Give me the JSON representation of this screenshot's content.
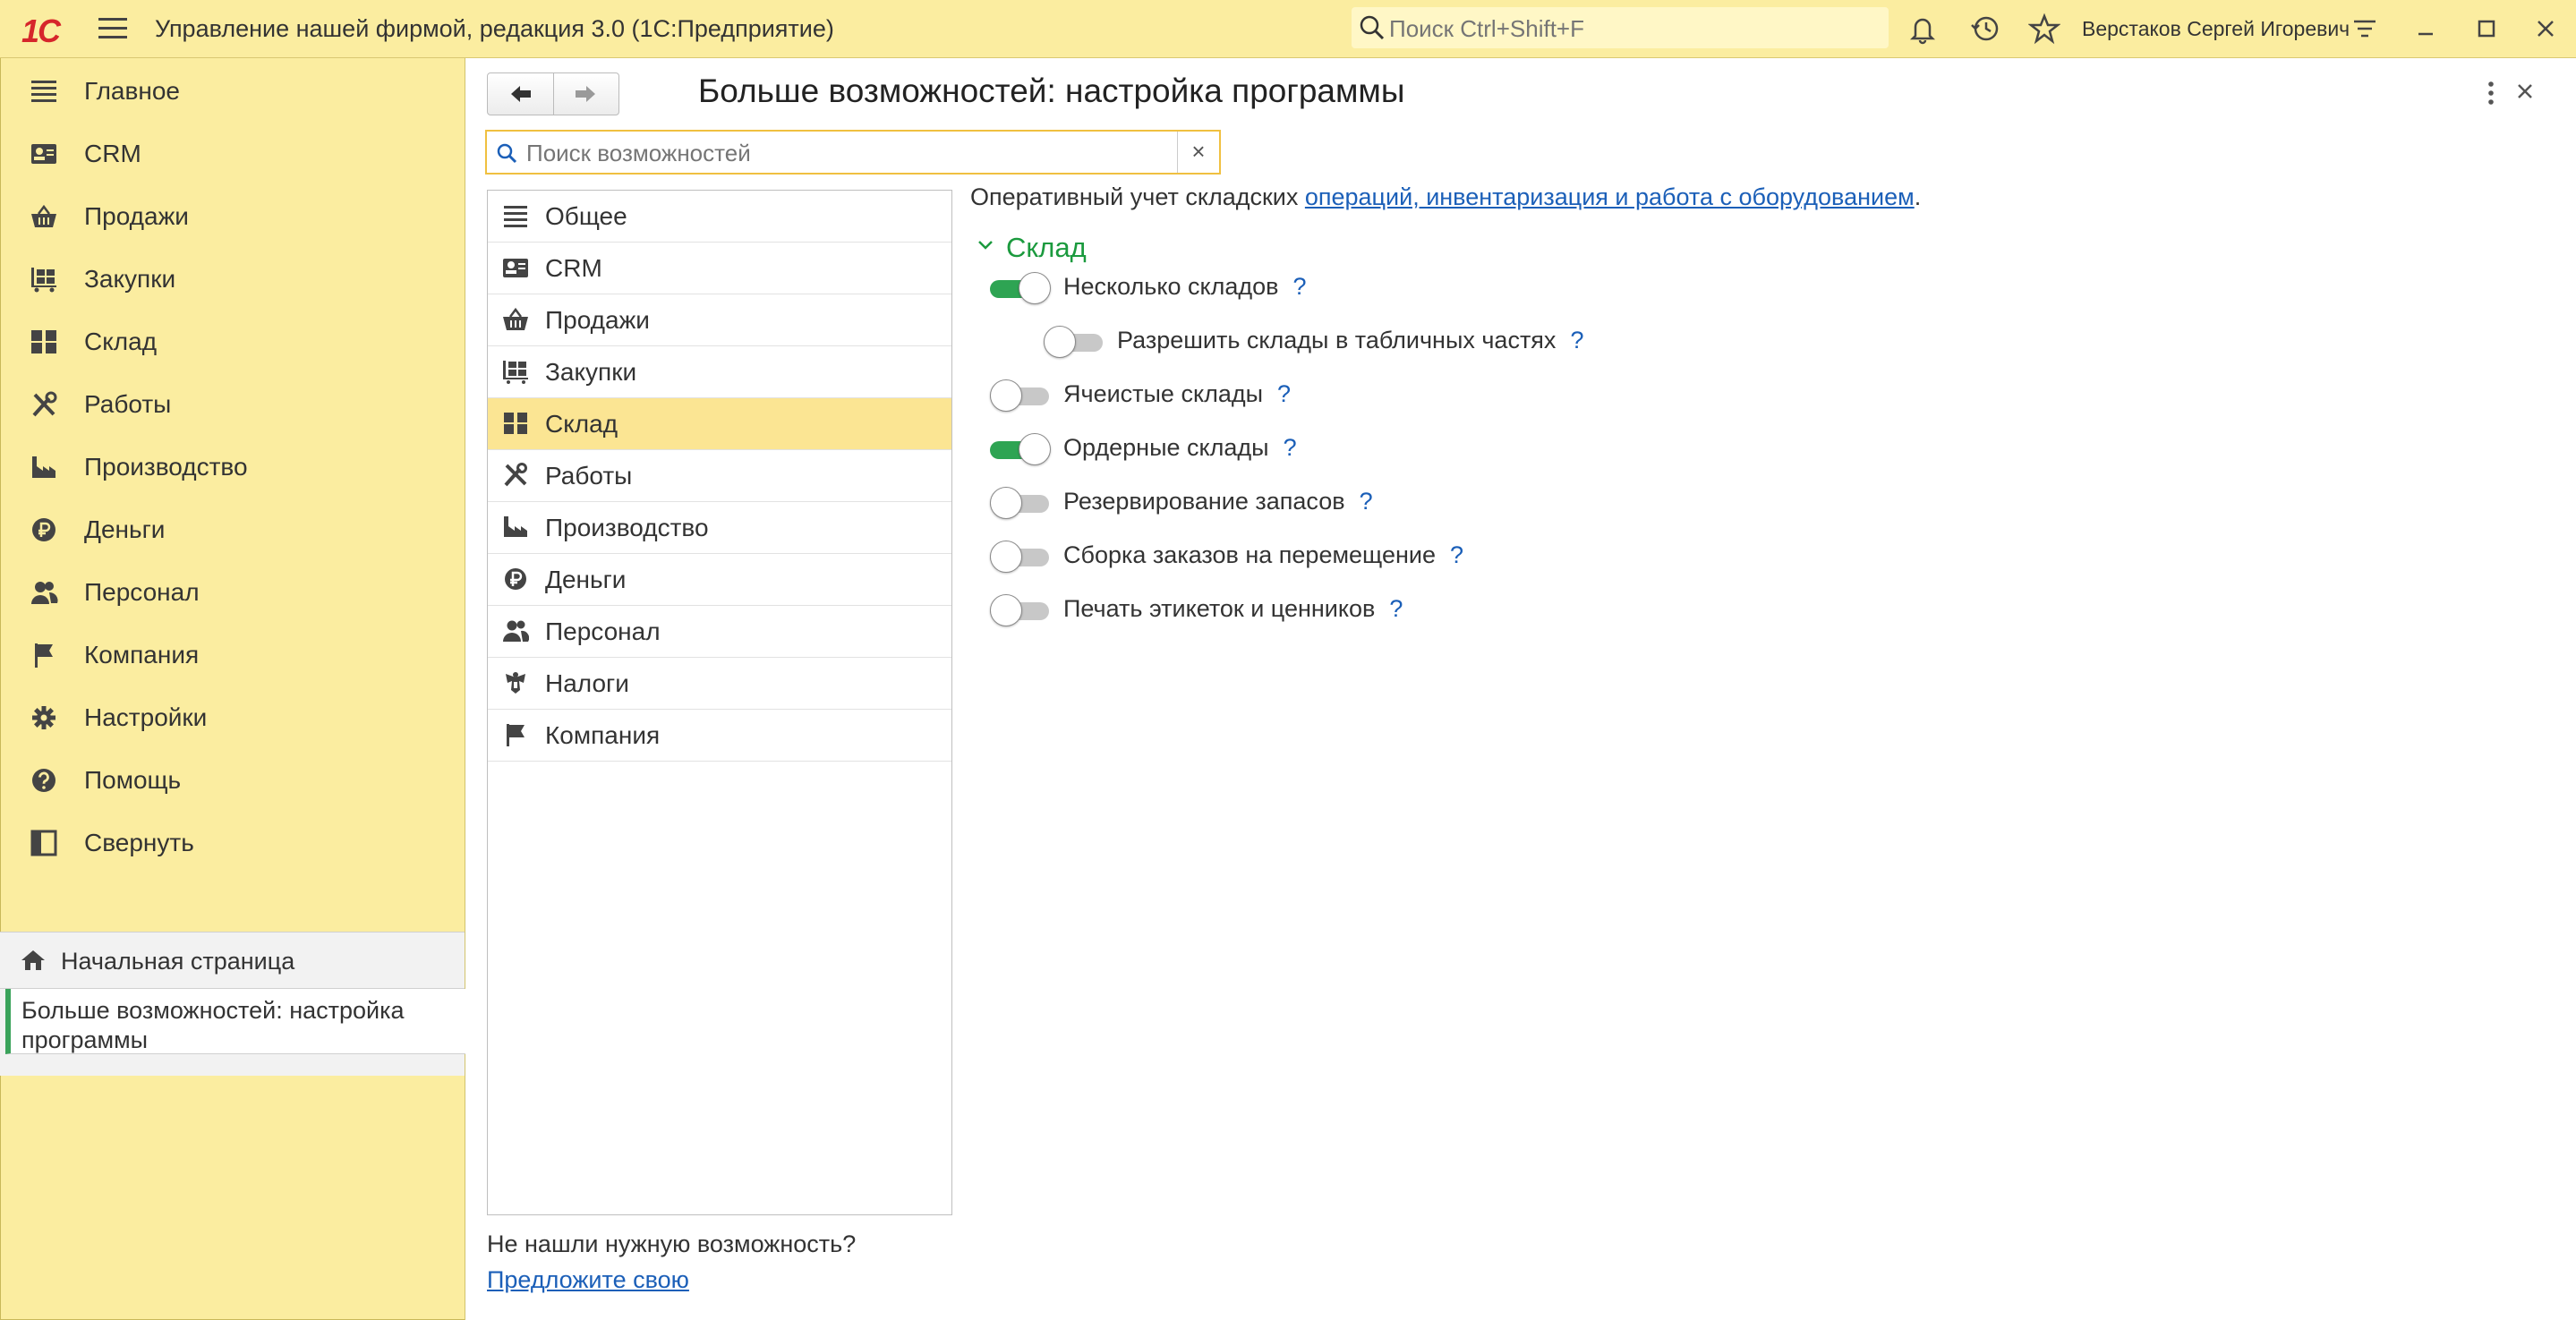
{
  "app": {
    "title": "Управление нашей фирмой, редакция 3.0  (1С:Предприятие)",
    "logo_text": "1С",
    "search_placeholder": "Поиск Ctrl+Shift+F",
    "user_name": "Верстаков Сергей Игоревич"
  },
  "sidebar": {
    "items": [
      {
        "label": "Главное",
        "icon": "list-icon"
      },
      {
        "label": "CRM",
        "icon": "contacts-icon"
      },
      {
        "label": "Продажи",
        "icon": "basket-icon"
      },
      {
        "label": "Закупки",
        "icon": "cart-icon"
      },
      {
        "label": "Склад",
        "icon": "grid-icon"
      },
      {
        "label": "Работы",
        "icon": "tools-icon"
      },
      {
        "label": "Производство",
        "icon": "factory-icon"
      },
      {
        "label": "Деньги",
        "icon": "ruble-icon"
      },
      {
        "label": "Персонал",
        "icon": "people-icon"
      },
      {
        "label": "Компания",
        "icon": "flag-icon"
      },
      {
        "label": "Настройки",
        "icon": "gear-icon"
      },
      {
        "label": "Помощь",
        "icon": "help-icon"
      },
      {
        "label": "Свернуть",
        "icon": "collapse-icon"
      }
    ],
    "home_label": "Начальная страница",
    "active_window": "Больше возможностей: настройка программы"
  },
  "main": {
    "title": "Больше возможностей: настройка программы",
    "search_placeholder": "Поиск возможностей",
    "search_value": "",
    "clear_label": "×",
    "categories": [
      {
        "label": "Общее",
        "icon": "list-icon"
      },
      {
        "label": "CRM",
        "icon": "contacts-icon"
      },
      {
        "label": "Продажи",
        "icon": "basket-icon"
      },
      {
        "label": "Закупки",
        "icon": "cart-icon"
      },
      {
        "label": "Склад",
        "icon": "grid-icon",
        "selected": true
      },
      {
        "label": "Работы",
        "icon": "tools-icon"
      },
      {
        "label": "Производство",
        "icon": "factory-icon"
      },
      {
        "label": "Деньги",
        "icon": "ruble-icon"
      },
      {
        "label": "Персонал",
        "icon": "people-icon"
      },
      {
        "label": "Налоги",
        "icon": "emblem-icon"
      },
      {
        "label": "Компания",
        "icon": "flag-icon"
      }
    ],
    "not_found_text": "Не нашли нужную возможность?",
    "suggest_link": "Предложите свою",
    "intro_text": "Оперативный учет складских ",
    "intro_link": "операций, инвентаризация и работа с оборудованием",
    "intro_end": ".",
    "section_title": "Склад",
    "options": [
      {
        "label": "Несколько складов",
        "on": true,
        "level": 0
      },
      {
        "label": "Разрешить склады в табличных частях",
        "on": false,
        "level": 1
      },
      {
        "label": "Ячеистые склады",
        "on": false,
        "level": 0
      },
      {
        "label": "Ордерные склады",
        "on": true,
        "level": 0
      },
      {
        "label": "Резервирование запасов",
        "on": false,
        "level": 0
      },
      {
        "label": "Сборка заказов на перемещение",
        "on": false,
        "level": 0
      },
      {
        "label": "Печать этикеток и ценников",
        "on": false,
        "level": 0
      }
    ],
    "help_mark": "?"
  },
  "colors": {
    "panel_bg": "#fbeda0",
    "selected_bg": "#fbe593",
    "toggle_on": "#2ea453",
    "section_green": "#1b9a3e",
    "link_blue": "#1b5fb8",
    "logo_red": "#d6262b"
  }
}
